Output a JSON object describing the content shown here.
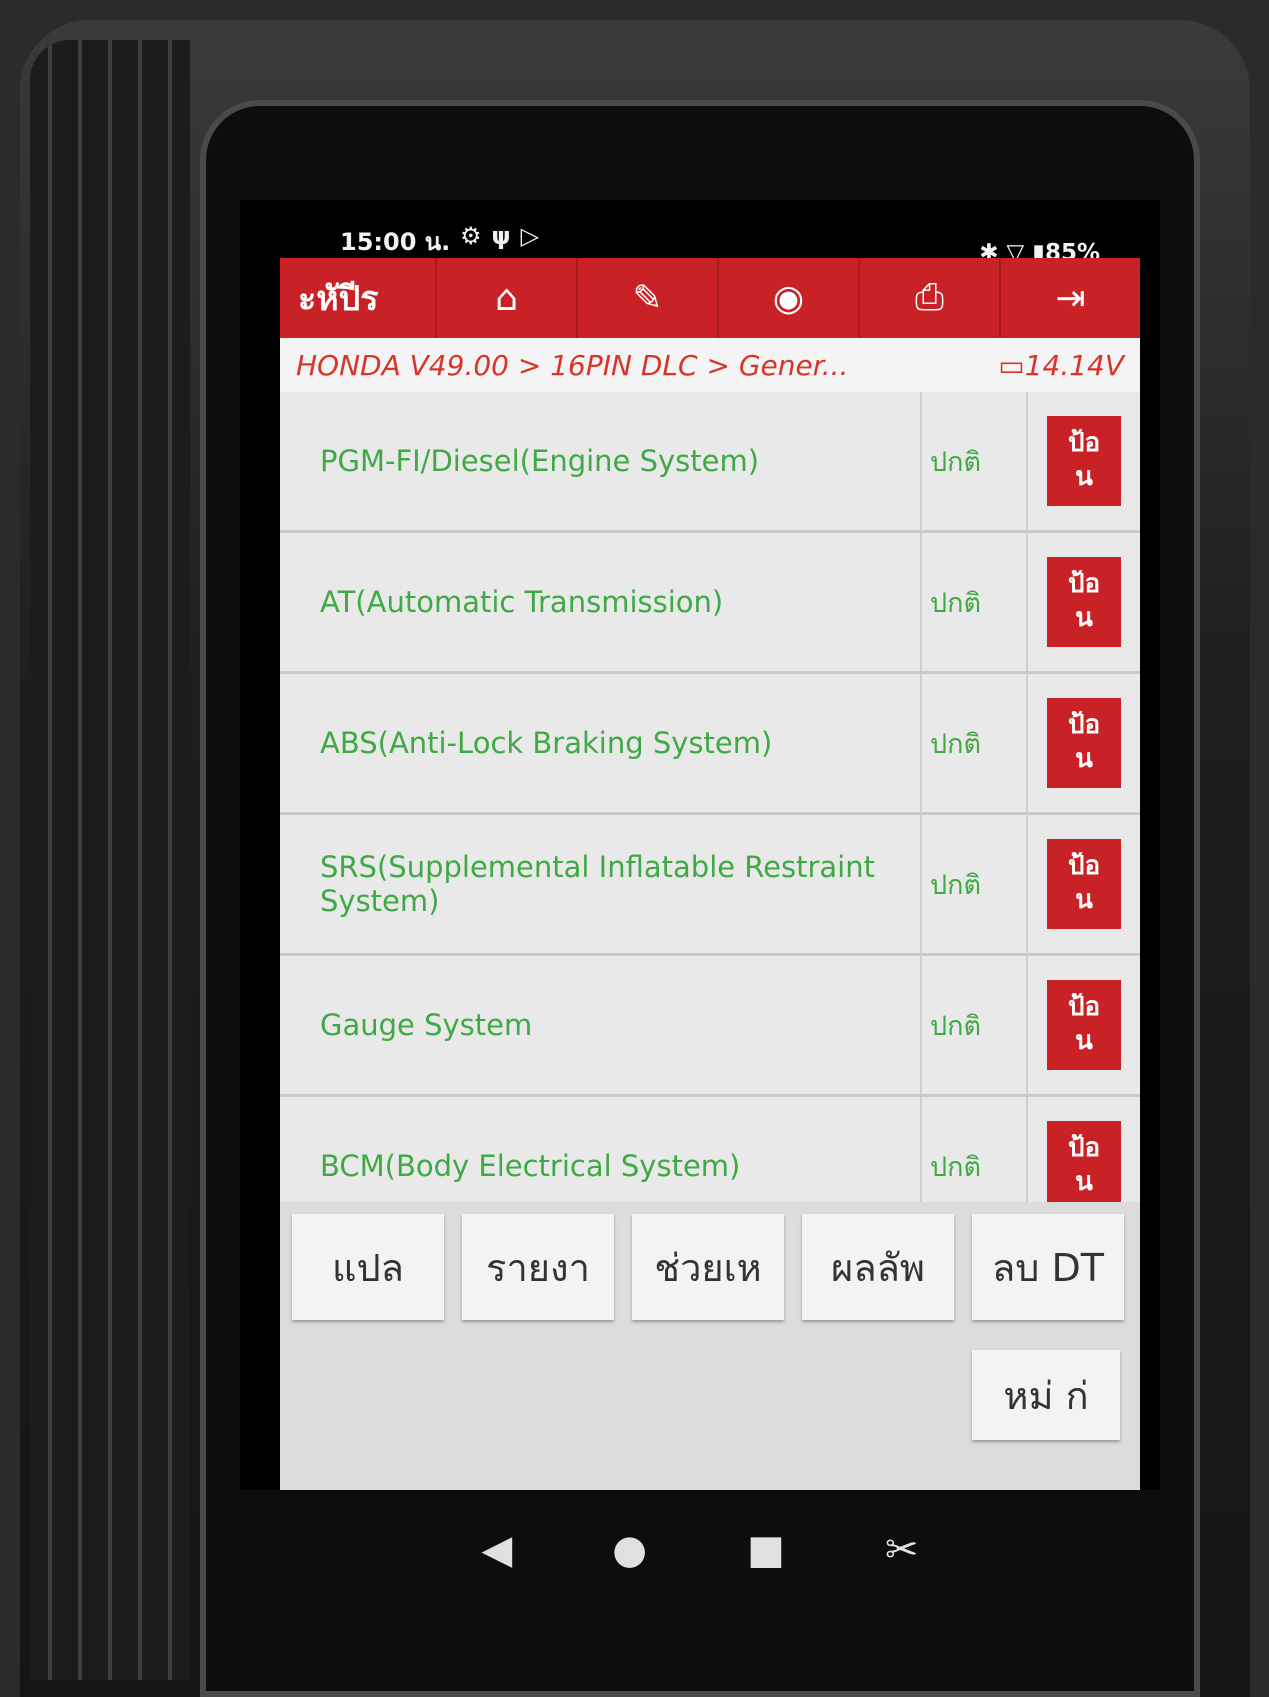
{
  "status_bar": {
    "time": "15:00 น.",
    "left_icons": [
      "settings-icon",
      "usb-icon",
      "play-icon"
    ],
    "battery": "85%",
    "right_icons": [
      "bluetooth-icon",
      "wifi-icon",
      "battery-icon"
    ]
  },
  "app_bar": {
    "title": "ะหัปีร",
    "tools": [
      {
        "name": "home-icon",
        "glyph": "⌂"
      },
      {
        "name": "edit-report-icon",
        "glyph": "✎"
      },
      {
        "name": "user-icon",
        "glyph": "◉"
      },
      {
        "name": "print-icon",
        "glyph": "⎙"
      },
      {
        "name": "exit-icon",
        "glyph": "⇥"
      }
    ]
  },
  "breadcrumb": {
    "path": "HONDA V49.00 > 16PIN DLC > Gener...",
    "voltage": "14.14V"
  },
  "systems": [
    {
      "name": "PGM-FI/Diesel(Engine System)",
      "status": "ปกติ",
      "action": "ป้อ\nน"
    },
    {
      "name": "AT(Automatic Transmission)",
      "status": "ปกติ",
      "action": "ป้อ\nน"
    },
    {
      "name": "ABS(Anti-Lock Braking System)",
      "status": "ปกติ",
      "action": "ป้อ\nน"
    },
    {
      "name": "SRS(Supplemental Inflatable Restraint System)",
      "status": "ปกติ",
      "action": "ป้อ\nน"
    },
    {
      "name": "Gauge System",
      "status": "ปกติ",
      "action": "ป้อ\nน"
    },
    {
      "name": "BCM(Body Electrical System)",
      "status": "ปกติ",
      "action": "ป้อ\nน"
    }
  ],
  "function_buttons": [
    "แปล",
    "รายงา",
    "ช่วยเห",
    "ผลลัพ",
    "ลบ DT"
  ],
  "new_button": "หม่ ก่",
  "nav_bar": {
    "back": "◀",
    "home": "●",
    "recents": "■",
    "screenshot": "✂"
  }
}
